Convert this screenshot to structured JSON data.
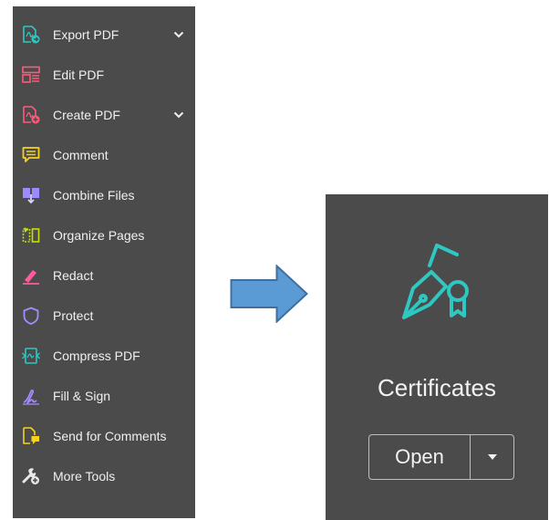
{
  "tools": [
    {
      "label": "Export PDF",
      "icon": "export-pdf-icon",
      "expandable": true
    },
    {
      "label": "Edit PDF",
      "icon": "edit-pdf-icon",
      "expandable": false
    },
    {
      "label": "Create PDF",
      "icon": "create-pdf-icon",
      "expandable": true
    },
    {
      "label": "Comment",
      "icon": "comment-icon",
      "expandable": false
    },
    {
      "label": "Combine Files",
      "icon": "combine-files-icon",
      "expandable": false
    },
    {
      "label": "Organize Pages",
      "icon": "organize-pages-icon",
      "expandable": false
    },
    {
      "label": "Redact",
      "icon": "redact-icon",
      "expandable": false
    },
    {
      "label": "Protect",
      "icon": "protect-icon",
      "expandable": false
    },
    {
      "label": "Compress PDF",
      "icon": "compress-pdf-icon",
      "expandable": false
    },
    {
      "label": "Fill & Sign",
      "icon": "fill-sign-icon",
      "expandable": false
    },
    {
      "label": "Send for Comments",
      "icon": "send-for-comments-icon",
      "expandable": false
    },
    {
      "label": "More Tools",
      "icon": "more-tools-icon",
      "expandable": false
    }
  ],
  "certificates": {
    "title": "Certificates",
    "icon": "certificate-pen-icon",
    "open_label": "Open",
    "dropdown_icon": "caret-down-icon"
  },
  "colors": {
    "panel_bg": "#4b4b4b",
    "text": "#f0f0f0",
    "accent_teal": "#2fc7c2",
    "arrow_fill": "#5b9bd5",
    "arrow_stroke": "#3e6f9e"
  }
}
